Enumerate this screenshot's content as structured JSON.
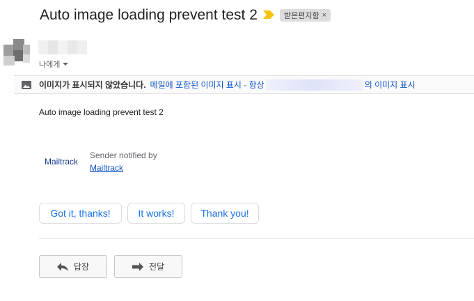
{
  "email": {
    "subject": "Auto image loading prevent test 2",
    "label": "받은편지함",
    "label_remove": "×",
    "recipient": "나에게",
    "body": "Auto image loading prevent test 2"
  },
  "image_banner": {
    "warning": "이미지가 표시되지 않았습니다.",
    "show_images": "메일에 포함된 이미지 표시 - 항상",
    "show_images_suffix": "의 이미지 표시"
  },
  "mailtrack": {
    "logo": "Mailtrack",
    "notified": "Sender notified by",
    "link": "Mailtrack"
  },
  "smart_replies": [
    "Got it, thanks!",
    "It works!",
    "Thank you!"
  ],
  "actions": {
    "reply": "답장",
    "forward": "전달"
  },
  "icons": {
    "importance": "importance-marker-icon",
    "image": "image-icon",
    "reply": "reply-arrow-icon",
    "forward": "forward-arrow-icon"
  },
  "colors": {
    "link": "#1155cc",
    "chip_text": "#1a73e8",
    "importance": "#f4c20d"
  }
}
